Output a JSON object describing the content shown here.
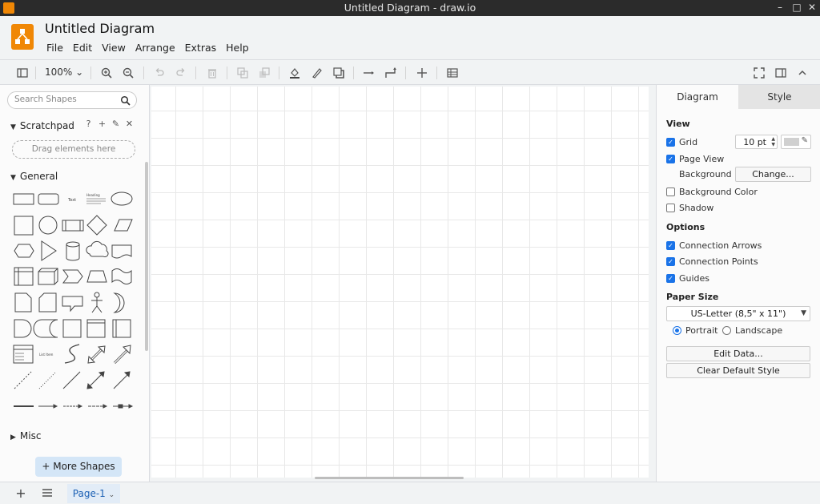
{
  "window": {
    "title": "Untitled Diagram - draw.io"
  },
  "header": {
    "doc_title": "Untitled Diagram",
    "menus": [
      "File",
      "Edit",
      "View",
      "Arrange",
      "Extras",
      "Help"
    ]
  },
  "toolbar": {
    "zoom": "100%"
  },
  "sidebar": {
    "search_placeholder": "Search Shapes",
    "scratchpad_label": "Scratchpad",
    "drop_hint": "Drag elements here",
    "general_label": "General",
    "misc_label": "Misc",
    "more_shapes_label": "+ More Shapes",
    "shape_text_label": "Text",
    "shape_heading_label": "Heading",
    "shape_list_label": "List Item"
  },
  "panel": {
    "tabs": [
      "Diagram",
      "Style"
    ],
    "view_heading": "View",
    "grid_label": "Grid",
    "grid_size": "10 pt",
    "page_view_label": "Page View",
    "background_label": "Background",
    "change_label": "Change...",
    "background_color_label": "Background Color",
    "shadow_label": "Shadow",
    "options_heading": "Options",
    "connection_arrows_label": "Connection Arrows",
    "connection_points_label": "Connection Points",
    "guides_label": "Guides",
    "paper_size_heading": "Paper Size",
    "paper_size_value": "US-Letter (8,5\" x 11\")",
    "portrait_label": "Portrait",
    "landscape_label": "Landscape",
    "edit_data_label": "Edit Data...",
    "clear_style_label": "Clear Default Style"
  },
  "settings": {
    "grid": true,
    "page_view": true,
    "background_color": false,
    "shadow": false,
    "connection_arrows": true,
    "connection_points": true,
    "guides": true,
    "orientation": "portrait"
  },
  "footer": {
    "page_tab": "Page-1"
  },
  "colors": {
    "accent": "#1a73e8",
    "brand": "#f08705",
    "titlebar": "#2b2b2b",
    "page_tab": "#e2ecf7"
  }
}
